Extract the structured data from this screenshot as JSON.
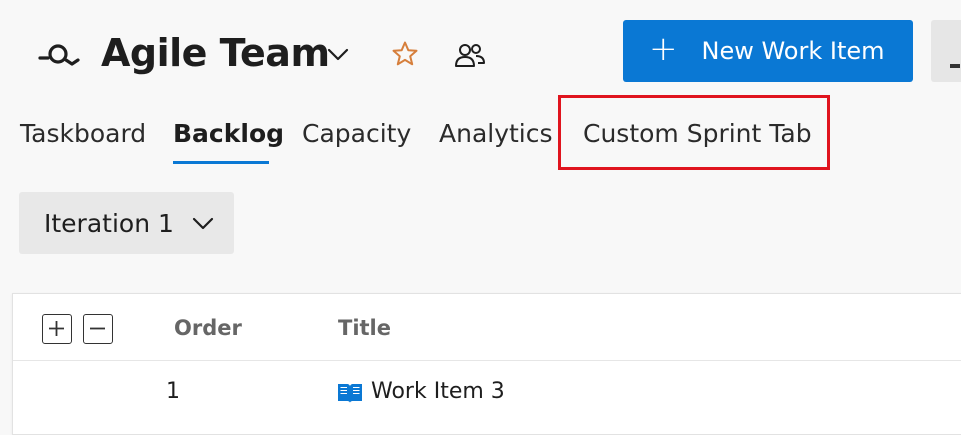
{
  "header": {
    "team_name": "Agile Team",
    "new_item_label": "New Work Item",
    "accent_color": "#0a78d4"
  },
  "tabs": [
    {
      "label": "Taskboard",
      "active": false
    },
    {
      "label": "Backlog",
      "active": true
    },
    {
      "label": "Capacity",
      "active": false
    },
    {
      "label": "Analytics",
      "active": false
    },
    {
      "label": "Custom Sprint Tab",
      "active": false,
      "highlighted": true
    }
  ],
  "filter": {
    "iteration_label": "Iteration 1"
  },
  "grid": {
    "columns": [
      "Order",
      "Title"
    ],
    "rows": [
      {
        "order": "1",
        "title": "Work Item 3",
        "icon": "book-icon"
      }
    ]
  },
  "icons": {
    "team": "team-icon",
    "favorite": "star-icon",
    "members": "people-icon",
    "expand_all": "plus-icon",
    "collapse_all": "minus-icon"
  },
  "colors": {
    "highlight": "#e0141e",
    "star": "#d67f3c",
    "book": "#0a78d4"
  }
}
